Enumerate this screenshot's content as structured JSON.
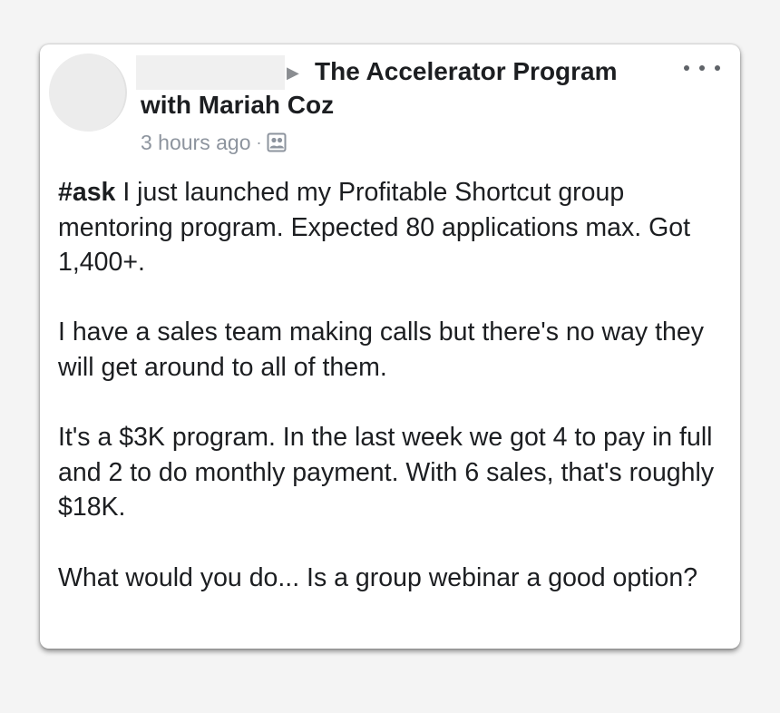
{
  "post": {
    "group_name_line1": "The Accelerator Program",
    "group_name_line2": "with Mariah Coz",
    "timestamp": "3 hours ago",
    "separator": "·",
    "arrow": "▶",
    "privacy_icon": "group-icon",
    "more_icon": "ellipsis-icon",
    "hashtag": "#ask",
    "paragraph1_rest": " I just launched my Profitable Shortcut group mentoring program. Expected 80 applications max. Got 1,400+.",
    "paragraph2": "I have a sales team making calls but there's no way they will get around to all of them.",
    "paragraph3": "It's a $3K program. In the last week we got 4 to pay in full and 2 to do monthly payment. With 6 sales, that's roughly $18K.",
    "paragraph4": "What would you do... Is a group webinar a good option?"
  },
  "colors": {
    "background": "#f4f4f4",
    "card": "#ffffff",
    "text": "#1c1e21",
    "meta": "#8d949e"
  }
}
